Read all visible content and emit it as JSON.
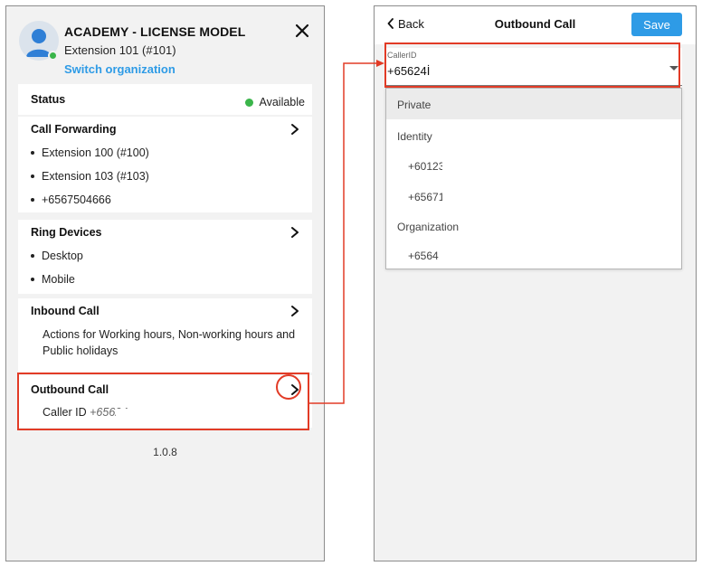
{
  "left_panel": {
    "org_name": "ACADEMY - LICENSE MODEL",
    "extension": "Extension 101 (#101)",
    "switch_org": "Switch organization",
    "status": {
      "label": "Status",
      "value": "Available",
      "color": "#3ab54a"
    },
    "call_forwarding": {
      "title": "Call Forwarding",
      "items": [
        "Extension 100 (#100)",
        "Extension 103 (#103)",
        "+6567504666"
      ]
    },
    "ring_devices": {
      "title": "Ring Devices",
      "items": [
        "Desktop",
        "Mobile"
      ]
    },
    "inbound_call": {
      "title": "Inbound Call",
      "description_line1": "Actions for Working hours, Non-working hours and",
      "description_line2": "Public holidays"
    },
    "outbound_call": {
      "title": "Outbound Call",
      "caller_id_label": "Caller ID",
      "caller_id_value": "+65624"
    },
    "version": "1.0.8"
  },
  "right_panel": {
    "back_label": "Back",
    "title": "Outbound Call",
    "save_label": "Save",
    "caller_id_field": {
      "label": "CallerID",
      "value": "+65624İ"
    },
    "options": {
      "private": "Private",
      "identity_header": "Identity",
      "identity_items": [
        "+60123",
        "+65671"
      ],
      "organization_header": "Organization",
      "organization_items": [
        "+6564:"
      ]
    }
  },
  "colors": {
    "accent": "#2e9be6",
    "annotation": "#e23b26",
    "available": "#3ab54a"
  },
  "icons": [
    "user-avatar-icon",
    "close-icon",
    "chevron-right-icon",
    "back-chevron-icon",
    "caret-down-icon"
  ]
}
